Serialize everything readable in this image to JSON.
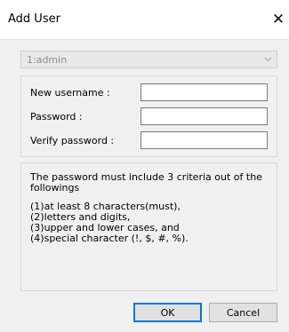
{
  "window": {
    "title": "Add User",
    "close_glyph": "✕"
  },
  "user_select": {
    "value": "1:admin",
    "disabled": true
  },
  "fields": {
    "new_username_label": "New username :",
    "password_label": "Password :",
    "verify_password_label": "Verify password :",
    "new_username_value": "",
    "password_value": "",
    "verify_password_value": ""
  },
  "info": {
    "line1": "The password must include 3 criteria out of the",
    "line2": "followings",
    "line3": "(1)at least 8 characters(must),",
    "line4": "(2)letters and digits,",
    "line5": "(3)upper and lower cases, and",
    "line6": "(4)special character (!, $, #, %)."
  },
  "buttons": {
    "ok_label": "OK",
    "cancel_label": "Cancel"
  },
  "icons": {
    "close": "close-icon",
    "dropdown": "chevron-down-icon"
  },
  "colors": {
    "background": "#f0f0f0",
    "titlebar": "#ffffff",
    "default_button_border": "#0078d7",
    "disabled_text": "#8c8c8c"
  }
}
